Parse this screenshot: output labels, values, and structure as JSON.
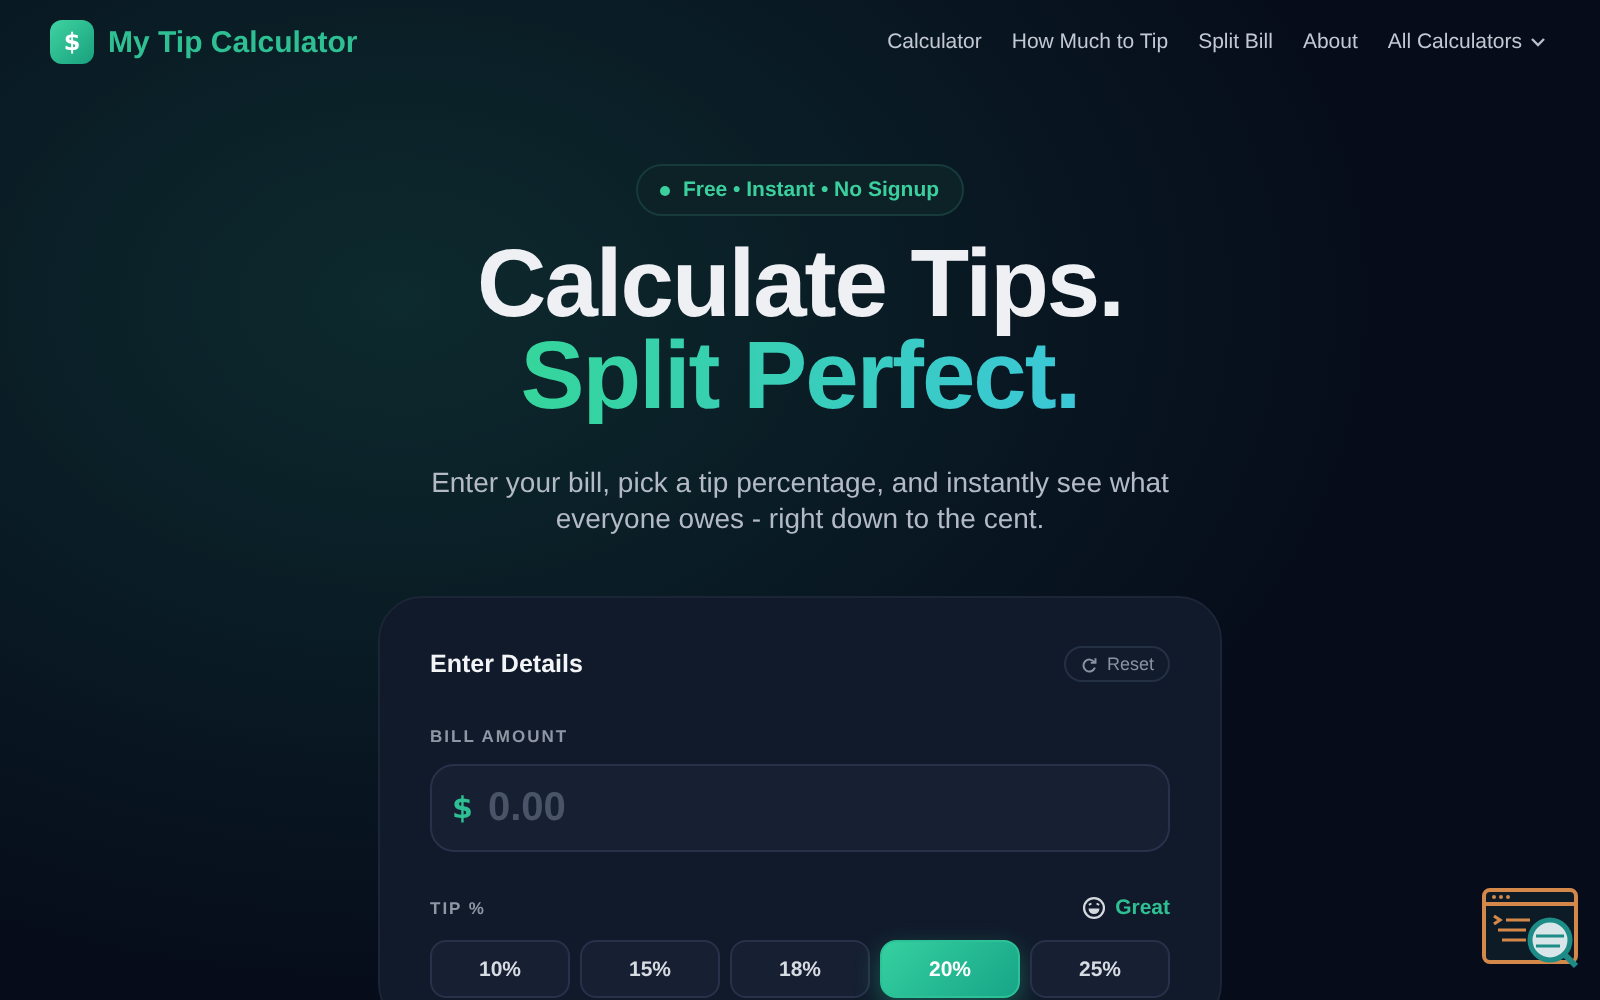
{
  "brand": {
    "logo": "$",
    "name": "My Tip Calculator"
  },
  "nav": [
    {
      "label": "Calculator",
      "kind": "link"
    },
    {
      "label": "How Much to Tip",
      "kind": "link"
    },
    {
      "label": "Split Bill",
      "kind": "link"
    },
    {
      "label": "About",
      "kind": "link"
    },
    {
      "label": "All Calculators",
      "kind": "dropdown"
    }
  ],
  "badge": "Free • Instant • No Signup",
  "headline": {
    "line_1": "Calculate Tips.",
    "line_2": "Split Perfect."
  },
  "subtitle": "Enter your bill, pick a tip percentage, and instantly see what everyone owes - right down to the cent.",
  "card": {
    "title": "Enter Details",
    "reset": "Reset",
    "bill_label": "BILL AMOUNT",
    "currency": "$",
    "bill_placeholder": "0.00",
    "tip_label": "TIP %",
    "tip_rating": "Great",
    "tips": [
      {
        "label": "10%",
        "selected": false
      },
      {
        "label": "15%",
        "selected": false
      },
      {
        "label": "18%",
        "selected": false
      },
      {
        "label": "20%",
        "selected": true
      },
      {
        "label": "25%",
        "selected": false
      }
    ]
  }
}
